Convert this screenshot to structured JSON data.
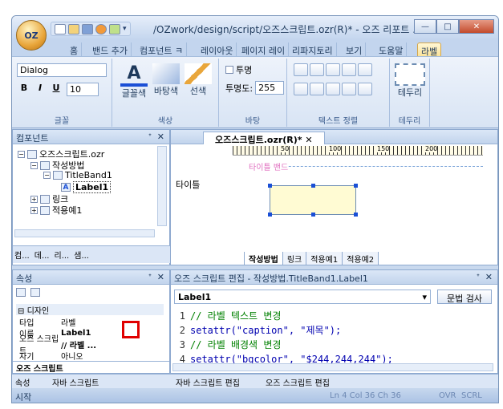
{
  "app": {
    "title": "/OZwork/design/script/오즈스크립트.ozr(R)* - 오즈 리포트 ...",
    "orb": "OZ"
  },
  "tabs": [
    "홈",
    "밴드 추가",
    "컴포넌트 ㅋ",
    "레이아웃",
    "페이지 레이",
    "리파지토리",
    "보기",
    "도움말",
    "라벨"
  ],
  "ribbon": {
    "font_name": "Dialog",
    "font_size": "10",
    "bold": "B",
    "italic": "I",
    "underline": "U",
    "group_font": "글꼴",
    "group_color": "색상",
    "group_transparent": "바탕",
    "group_textalign": "텍스트 정렬",
    "group_border": "테두리",
    "font_color": "글꼴색",
    "bg_color": "바탕색",
    "line_color": "선색",
    "transparent_check": "투명",
    "opacity_label": "투명도:",
    "opacity_value": "255",
    "border_label": "테두리"
  },
  "left_pane": {
    "title": "컴포넌트",
    "tree": [
      "오즈스크립트.ozr",
      "작성방법",
      "TitleBand1",
      "Label1",
      "링크",
      "적용예1"
    ],
    "bottom_tabs": [
      "컴...",
      "데...",
      "리...",
      "샘..."
    ]
  },
  "editor": {
    "tab": "오즈스크립트.ozr(R)*",
    "band_label": "타이틀 밴드",
    "row_label": "타이틀",
    "ruler_ticks": [
      "50",
      "100",
      "150",
      "200"
    ],
    "sheets": [
      "작성방법",
      "링크",
      "적용예1",
      "적용예2"
    ]
  },
  "props": {
    "title": "속성",
    "category": "디자인",
    "rows": [
      {
        "name": "타입",
        "value": "라벨"
      },
      {
        "name": "이름",
        "value": "Label1"
      },
      {
        "name": "오즈 스크립트",
        "value": "// 라벨 ..."
      },
      {
        "name": "자기",
        "value": "아니오"
      }
    ],
    "footer": "오즈 스크립트"
  },
  "script_editor": {
    "title": "오즈 스크립트 편집 - 작성방법.TitleBand1.Label1",
    "selected": "Label1",
    "check_button": "문법 검사",
    "lines": [
      {
        "n": "1",
        "t": "// 라벨 텍스트 변경"
      },
      {
        "n": "2",
        "t": "setattr(\"caption\", \"제목\");"
      },
      {
        "n": "3",
        "t": "// 라벨 배경색 변경"
      },
      {
        "n": "4",
        "t": "setattr(\"bgcolor\", \"$244,244,244\");"
      }
    ]
  },
  "bottom_tabs": [
    "속성",
    "자바 스크립트",
    "자바 스크립트 편집",
    "오즈 스크립트 편집"
  ],
  "status": {
    "left": "시작",
    "pos": "Ln 4  Col 36  Ch 36",
    "ovr": "OVR",
    "scrl": "SCRL"
  }
}
